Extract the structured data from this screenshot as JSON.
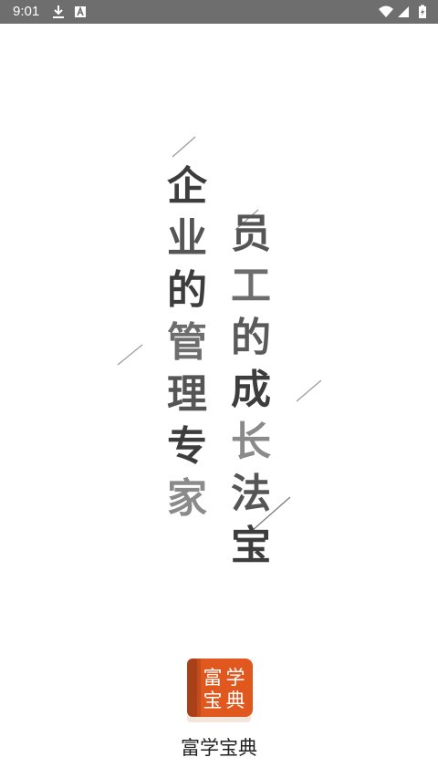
{
  "status_bar": {
    "time": "9:01",
    "icons": [
      "download-icon",
      "a-badge-icon",
      "wifi-icon",
      "signal-icon",
      "battery-icon"
    ]
  },
  "slogan": {
    "left": [
      "企",
      "业",
      "的",
      "管",
      "理",
      "专",
      "家"
    ],
    "right": [
      "员",
      "工",
      "的",
      "成",
      "长",
      "法",
      "宝"
    ]
  },
  "app": {
    "logo_text": [
      "富",
      "学",
      "宝",
      "典"
    ],
    "name": "富学宝典",
    "brand_color": "#e0581e"
  }
}
